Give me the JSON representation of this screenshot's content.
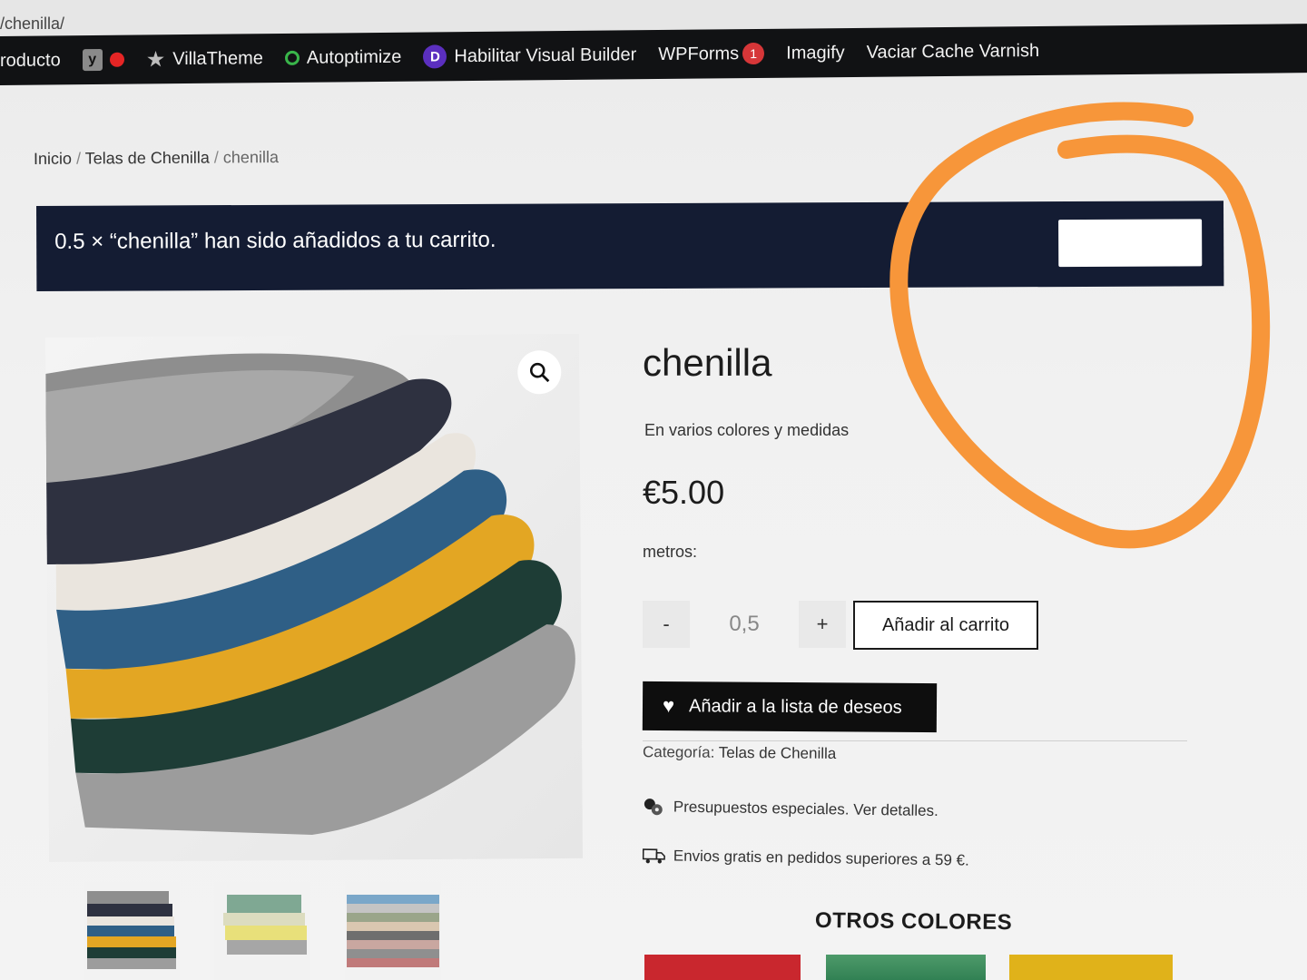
{
  "browser": {
    "url_fragment": "/chenilla/"
  },
  "admin_bar": {
    "items": [
      {
        "label": "roducto"
      },
      {
        "label": "VillaTheme"
      },
      {
        "label": "Autoptimize"
      },
      {
        "label": "Habilitar Visual Builder"
      },
      {
        "label": "WPForms",
        "badge": "1"
      },
      {
        "label": "Imagify"
      },
      {
        "label": "Vaciar Cache Varnish"
      }
    ],
    "yoast_glyph": "y",
    "divi_glyph": "D"
  },
  "breadcrumb": {
    "home": "Inicio",
    "category": "Telas de Chenilla",
    "current": "chenilla",
    "separator": "/"
  },
  "notice": {
    "message": "0.5 × “chenilla” han sido añadidos a tu carrito.",
    "button_label": ""
  },
  "product": {
    "title": "chenilla",
    "short_description": "En varios colores y medidas",
    "price": "€5.00",
    "quantity_label": "metros:",
    "quantity_value": "0,5",
    "minus_label": "-",
    "plus_label": "+",
    "add_to_cart_label": "Añadir al carrito",
    "wishlist_label": "Añadir a la lista de deseos",
    "category_label": "Categoría:",
    "category_value": "Telas de Chenilla",
    "info_special_budget": "Presupuestos especiales. Ver detalles.",
    "info_free_shipping": "Envios gratis en pedidos superiores a 59 €.",
    "other_colors_heading": "OTROS COLORES"
  },
  "icons": {
    "zoom": "search-icon",
    "heart": "heart-icon",
    "fabric_roll": "fabric-roll-icon",
    "truck": "truck-icon"
  },
  "colors": {
    "notice_bg": "#141c33",
    "admin_bar_bg": "#111214",
    "annotation": "#f7963a",
    "swatch_red": "#c9272e",
    "swatch_green": "#3f8d5f",
    "swatch_yellow": "#e0b21a"
  }
}
